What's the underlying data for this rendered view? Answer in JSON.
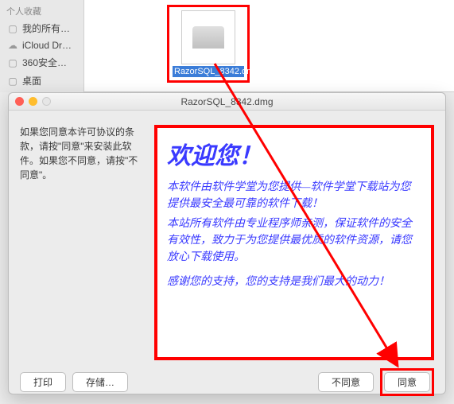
{
  "sidebar": {
    "header": "个人收藏",
    "items": [
      {
        "icon": "📁",
        "label": "我的所有…"
      },
      {
        "icon": "☁",
        "label": "iCloud Dr…"
      },
      {
        "icon": "📁",
        "label": "360安全…"
      },
      {
        "icon": "📁",
        "label": "桌面"
      }
    ]
  },
  "file": {
    "name": "RazorSQL_8342.dmg"
  },
  "dialog": {
    "title": "RazorSQL_8342.dmg",
    "instructions": "如果您同意本许可协议的条款，请按\"同意\"来安装此软件。如果您不同意，请按\"不同意\"。",
    "license_title": "欢迎您！",
    "license_body": [
      "本软件由软件学堂为您提供—软件学堂下载站为您提供最安全最可靠的软件下载！",
      "本站所有软件由专业程序师亲测，保证软件的安全有效性，致力于为您提供最优质的软件资源，请您放心下载使用。",
      "感谢您的支持，您的支持是我们最大的动力！"
    ],
    "buttons": {
      "print": "打印",
      "save": "存储…",
      "disagree": "不同意",
      "agree": "同意"
    }
  }
}
